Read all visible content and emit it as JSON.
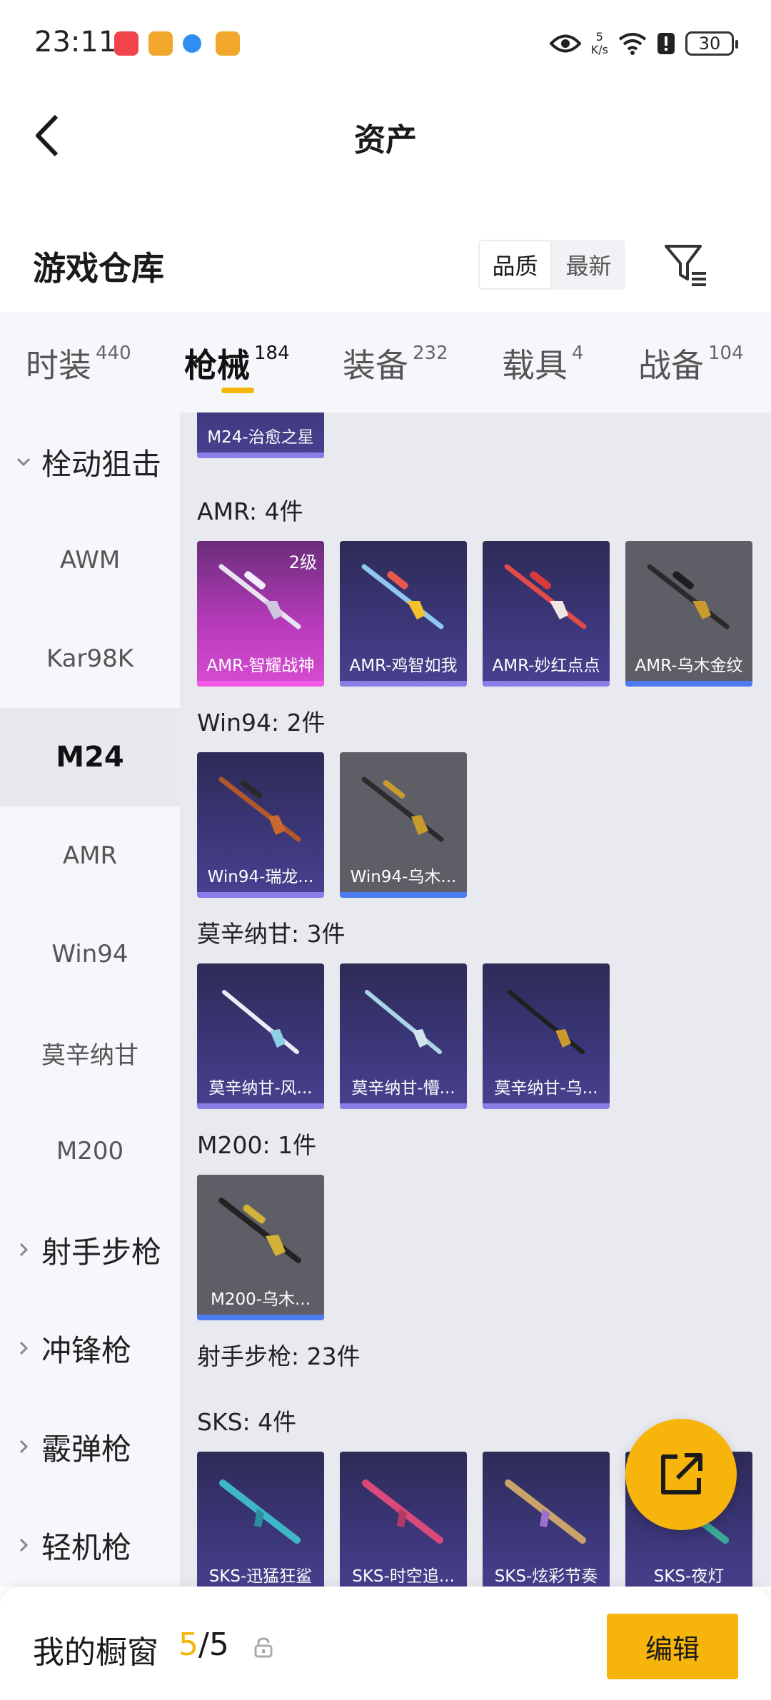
{
  "status_bar": {
    "time": "23:11",
    "net_speed_value": "5",
    "net_speed_unit": "K/s",
    "battery": "30"
  },
  "header": {
    "title": "资产"
  },
  "warehouse": {
    "title": "游戏仓库",
    "sort_options": [
      {
        "label": "品质",
        "active": true
      },
      {
        "label": "最新",
        "active": false
      }
    ]
  },
  "tabs": [
    {
      "label": "时装",
      "count": "440",
      "active": false
    },
    {
      "label": "枪械",
      "count": "184",
      "active": true
    },
    {
      "label": "装备",
      "count": "232",
      "active": false
    },
    {
      "label": "载具",
      "count": "4",
      "active": false
    },
    {
      "label": "战备",
      "count": "104",
      "active": false
    }
  ],
  "sidebar": {
    "groups": [
      {
        "label": "栓动狙击",
        "expanded": true
      },
      {
        "label": "射手步枪",
        "expanded": false
      },
      {
        "label": "冲锋枪",
        "expanded": false
      },
      {
        "label": "霰弹枪",
        "expanded": false
      },
      {
        "label": "轻机枪",
        "expanded": false
      }
    ],
    "items": [
      {
        "label": "AWM",
        "active": false
      },
      {
        "label": "Kar98K",
        "active": false
      },
      {
        "label": "M24",
        "active": true
      },
      {
        "label": "AMR",
        "active": false
      },
      {
        "label": "Win94",
        "active": false
      },
      {
        "label": "莫辛纳甘",
        "active": false
      },
      {
        "label": "M200",
        "active": false
      }
    ]
  },
  "content": {
    "partial_card": {
      "label": "M24-治愈之星"
    },
    "sections": [
      {
        "title": "AMR: 4件",
        "items": [
          {
            "label": "AMR-智耀战神",
            "level": "2级",
            "rarity": "pink"
          },
          {
            "label": "AMR-鸡智如我",
            "rarity": "purple"
          },
          {
            "label": "AMR-妙红点点",
            "rarity": "purple"
          },
          {
            "label": "AMR-乌木金纹",
            "rarity": "gray"
          }
        ]
      },
      {
        "title": "Win94: 2件",
        "items": [
          {
            "label": "Win94-瑞龙...",
            "rarity": "purple"
          },
          {
            "label": "Win94-乌木...",
            "rarity": "gray"
          }
        ]
      },
      {
        "title": "莫辛纳甘: 3件",
        "items": [
          {
            "label": "莫辛纳甘-风...",
            "rarity": "purple"
          },
          {
            "label": "莫辛纳甘-懵...",
            "rarity": "purple"
          },
          {
            "label": "莫辛纳甘-乌...",
            "rarity": "purple"
          }
        ]
      },
      {
        "title": "M200: 1件",
        "items": [
          {
            "label": "M200-乌木...",
            "rarity": "gray"
          }
        ]
      }
    ],
    "category_title": "射手步枪: 23件",
    "sks": {
      "title": "SKS: 4件",
      "items": [
        {
          "label": "SKS-迅猛狂鲨",
          "rarity": "purple"
        },
        {
          "label": "SKS-时空追...",
          "rarity": "purple"
        },
        {
          "label": "SKS-炫彩节奏",
          "rarity": "purple"
        },
        {
          "label": "SKS-夜灯",
          "rarity": "purple"
        }
      ]
    }
  },
  "bottom_bar": {
    "label": "我的橱窗",
    "current": "5",
    "sep": "/",
    "total": "5",
    "edit_label": "编辑"
  },
  "colors": {
    "accent": "#f7b50b",
    "purple_bar": "#8b7de8",
    "gray_bar": "#4d7cf0",
    "pink_bar": "#f159e6"
  }
}
